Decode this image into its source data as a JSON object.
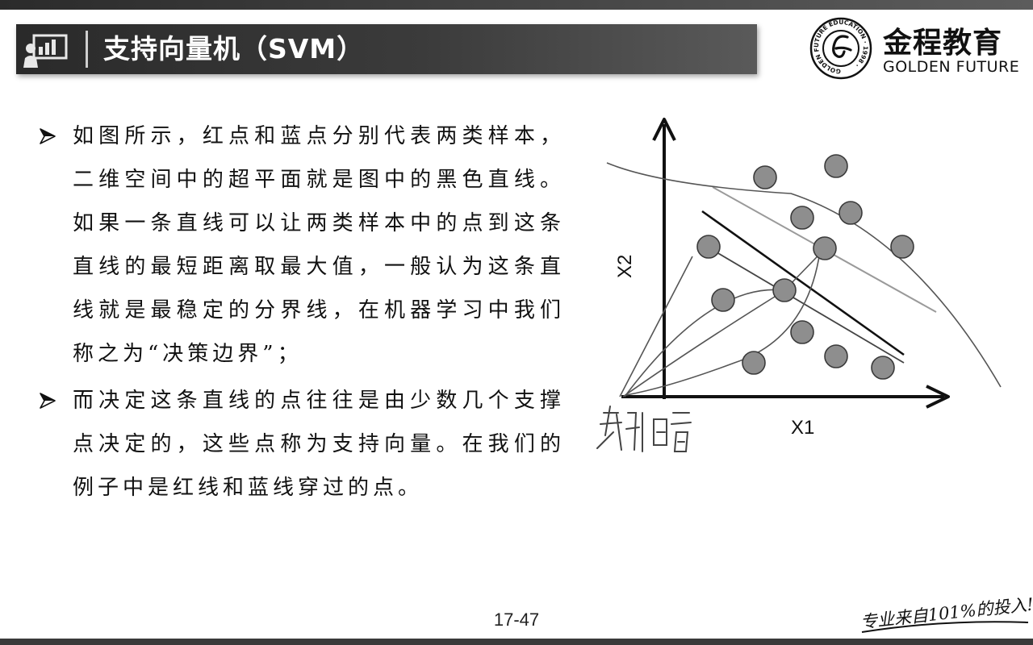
{
  "slide": {
    "title": "支持向量机（SVM）",
    "page_number": "17-47"
  },
  "logo": {
    "name_cn": "金程教育",
    "name_en": "GOLDEN FUTURE",
    "ring_text": "GOLDEN FUTURE EDUCATION",
    "year": "1998"
  },
  "bullets": [
    "如图所示，红点和蓝点分别代表两类样本，二维空间中的超平面就是图中的黑色直线。如果一条直线可以让两类样本中的点到这条直线的最短距离取最大值，一般认为这条直线就是最稳定的分界线，在机器学习中我们称之为“决策边界”；",
    "而决定这条直线的点往往是由少数几个支撑点决定的，这些点称为支持向量。在我们的例子中是红线和蓝线穿过的点。"
  ],
  "diagram": {
    "x_axis_label": "X1",
    "y_axis_label": "X2",
    "handwritten_note": "对偶"
  },
  "footer": {
    "slogan": "专业来自101%的投入!"
  },
  "colors": {
    "title_bar": "#333333",
    "point_fill": "#8e8e8e",
    "accent": "#111111"
  }
}
